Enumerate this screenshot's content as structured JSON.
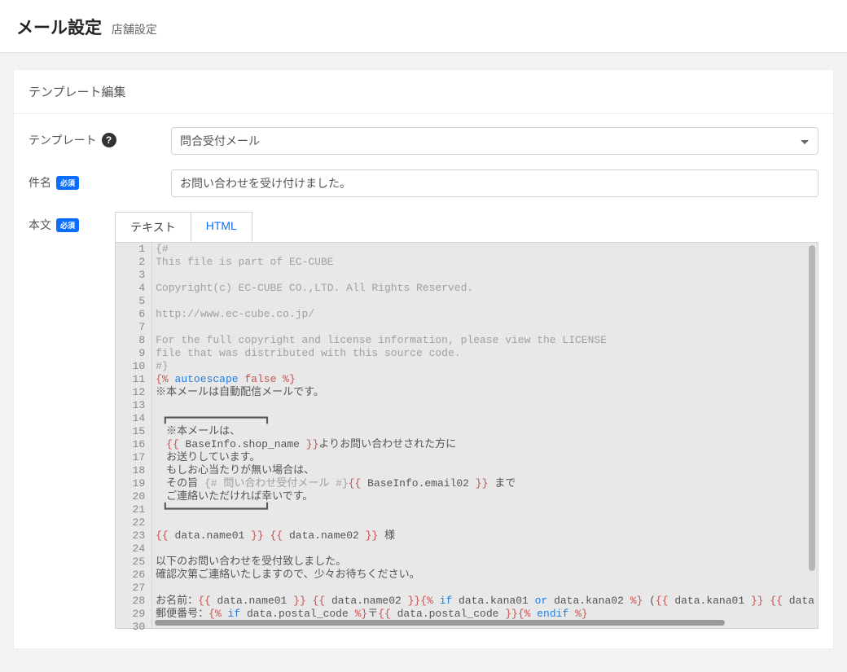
{
  "header": {
    "title": "メール設定",
    "subtitle": "店舗設定"
  },
  "card": {
    "title": "テンプレート編集"
  },
  "form": {
    "template_label": "テンプレート",
    "template_value": "問合受付メール",
    "subject_label": "件名",
    "subject_value": "お問い合わせを受け付けました。",
    "body_label": "本文",
    "required_badge": "必須"
  },
  "tabs": {
    "text": "テキスト",
    "html": "HTML"
  },
  "editor": {
    "lines": [
      {
        "n": 1,
        "segs": [
          {
            "t": "{#",
            "c": "tk-cmt"
          }
        ]
      },
      {
        "n": 2,
        "segs": [
          {
            "t": "This file is part of EC-CUBE",
            "c": "tk-cmt"
          }
        ]
      },
      {
        "n": 3,
        "segs": [
          {
            "t": "",
            "c": ""
          }
        ]
      },
      {
        "n": 4,
        "segs": [
          {
            "t": "Copyright(c) EC-CUBE CO.,LTD. All Rights Reserved.",
            "c": "tk-cmt"
          }
        ]
      },
      {
        "n": 5,
        "segs": [
          {
            "t": "",
            "c": ""
          }
        ]
      },
      {
        "n": 6,
        "segs": [
          {
            "t": "http://www.ec-cube.co.jp/",
            "c": "tk-cmt"
          }
        ]
      },
      {
        "n": 7,
        "segs": [
          {
            "t": "",
            "c": ""
          }
        ]
      },
      {
        "n": 8,
        "segs": [
          {
            "t": "For the full copyright and license information, please view the LICENSE",
            "c": "tk-cmt"
          }
        ]
      },
      {
        "n": 9,
        "segs": [
          {
            "t": "file that was distributed with this source code.",
            "c": "tk-cmt"
          }
        ]
      },
      {
        "n": 10,
        "segs": [
          {
            "t": "#}",
            "c": "tk-cmt"
          }
        ]
      },
      {
        "n": 11,
        "segs": [
          {
            "t": "{% ",
            "c": "tk-tag"
          },
          {
            "t": "autoescape ",
            "c": "tk-key"
          },
          {
            "t": "false ",
            "c": "tk-kw2"
          },
          {
            "t": "%}",
            "c": "tk-tag"
          }
        ]
      },
      {
        "n": 12,
        "segs": [
          {
            "t": "※本メールは自動配信メールです。",
            "c": ""
          }
        ]
      },
      {
        "n": 13,
        "segs": [
          {
            "t": "",
            "c": ""
          }
        ]
      },
      {
        "n": 14,
        "segs": [
          {
            "t": " ┏━━━━━━━━━━━━━━━┓",
            "c": ""
          }
        ]
      },
      {
        "n": 15,
        "segs": [
          {
            "t": "　※本メールは、",
            "c": ""
          }
        ]
      },
      {
        "n": 16,
        "segs": [
          {
            "t": "　",
            "c": ""
          },
          {
            "t": "{{ ",
            "c": "tk-var"
          },
          {
            "t": "BaseInfo.shop_name",
            "c": ""
          },
          {
            "t": " }}",
            "c": "tk-var"
          },
          {
            "t": "よりお問い合わせされた方に",
            "c": ""
          }
        ]
      },
      {
        "n": 17,
        "segs": [
          {
            "t": "　お送りしています。",
            "c": ""
          }
        ]
      },
      {
        "n": 18,
        "segs": [
          {
            "t": "　もしお心当たりが無い場合は、",
            "c": ""
          }
        ]
      },
      {
        "n": 19,
        "segs": [
          {
            "t": "　その旨 ",
            "c": ""
          },
          {
            "t": "{# 問い合わせ受付メール #}",
            "c": "tk-cmt"
          },
          {
            "t": "{{ ",
            "c": "tk-var"
          },
          {
            "t": "BaseInfo.email02",
            "c": ""
          },
          {
            "t": " }}",
            "c": "tk-var"
          },
          {
            "t": " まで",
            "c": ""
          }
        ]
      },
      {
        "n": 20,
        "segs": [
          {
            "t": "　ご連絡いただければ幸いです。",
            "c": ""
          }
        ]
      },
      {
        "n": 21,
        "segs": [
          {
            "t": " ┗━━━━━━━━━━━━━━━┛",
            "c": ""
          }
        ]
      },
      {
        "n": 22,
        "segs": [
          {
            "t": "",
            "c": ""
          }
        ]
      },
      {
        "n": 23,
        "segs": [
          {
            "t": "{{ ",
            "c": "tk-var"
          },
          {
            "t": "data.name01",
            "c": ""
          },
          {
            "t": " }}",
            "c": "tk-var"
          },
          {
            "t": " ",
            "c": ""
          },
          {
            "t": "{{ ",
            "c": "tk-var"
          },
          {
            "t": "data.name02",
            "c": ""
          },
          {
            "t": " }}",
            "c": "tk-var"
          },
          {
            "t": " 様",
            "c": ""
          }
        ]
      },
      {
        "n": 24,
        "segs": [
          {
            "t": "",
            "c": ""
          }
        ]
      },
      {
        "n": 25,
        "segs": [
          {
            "t": "以下のお問い合わせを受付致しました。",
            "c": ""
          }
        ]
      },
      {
        "n": 26,
        "segs": [
          {
            "t": "確認次第ご連絡いたしますので、少々お待ちください。",
            "c": ""
          }
        ]
      },
      {
        "n": 27,
        "segs": [
          {
            "t": "",
            "c": ""
          }
        ]
      },
      {
        "n": 28,
        "segs": [
          {
            "t": "お名前：",
            "c": ""
          },
          {
            "t": "{{ ",
            "c": "tk-var"
          },
          {
            "t": "data.name01",
            "c": ""
          },
          {
            "t": " }}",
            "c": "tk-var"
          },
          {
            "t": " ",
            "c": ""
          },
          {
            "t": "{{ ",
            "c": "tk-var"
          },
          {
            "t": "data.name02",
            "c": ""
          },
          {
            "t": " }}",
            "c": "tk-var"
          },
          {
            "t": "{% ",
            "c": "tk-tag"
          },
          {
            "t": "if ",
            "c": "tk-key"
          },
          {
            "t": "data.kana01 ",
            "c": ""
          },
          {
            "t": "or ",
            "c": "tk-key"
          },
          {
            "t": "data.kana02 ",
            "c": ""
          },
          {
            "t": "%}",
            "c": "tk-tag"
          },
          {
            "t": " (",
            "c": ""
          },
          {
            "t": "{{ ",
            "c": "tk-var"
          },
          {
            "t": "data.kana01",
            "c": ""
          },
          {
            "t": " }}",
            "c": "tk-var"
          },
          {
            "t": " ",
            "c": ""
          },
          {
            "t": "{{ ",
            "c": "tk-var"
          },
          {
            "t": "data",
            "c": ""
          }
        ]
      },
      {
        "n": 29,
        "segs": [
          {
            "t": "郵便番号：",
            "c": ""
          },
          {
            "t": "{% ",
            "c": "tk-tag"
          },
          {
            "t": "if ",
            "c": "tk-key"
          },
          {
            "t": "data.postal_code ",
            "c": ""
          },
          {
            "t": "%}",
            "c": "tk-tag"
          },
          {
            "t": "〒",
            "c": ""
          },
          {
            "t": "{{ ",
            "c": "tk-var"
          },
          {
            "t": "data.postal_code",
            "c": ""
          },
          {
            "t": " }}",
            "c": "tk-var"
          },
          {
            "t": "{% ",
            "c": "tk-tag"
          },
          {
            "t": "endif ",
            "c": "tk-key"
          },
          {
            "t": "%}",
            "c": "tk-tag"
          }
        ]
      },
      {
        "n": 30,
        "segs": [
          {
            "t": "",
            "c": ""
          }
        ]
      }
    ]
  }
}
